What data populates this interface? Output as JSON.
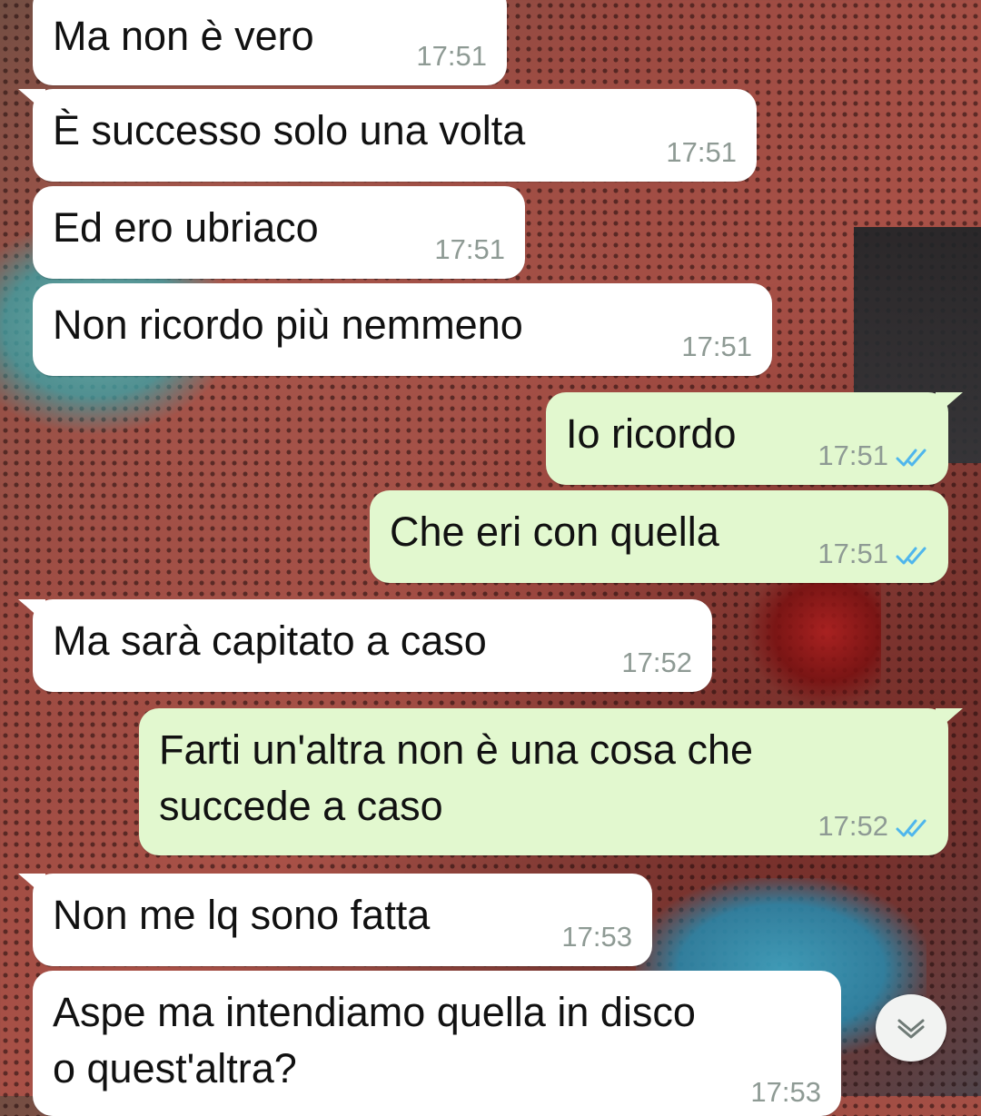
{
  "chat": {
    "messages": [
      {
        "direction": "in",
        "text": "Ma non è vero",
        "time": "17:51"
      },
      {
        "direction": "in",
        "text": "È successo solo una volta",
        "time": "17:51"
      },
      {
        "direction": "in",
        "text": "Ed ero ubriaco",
        "time": "17:51"
      },
      {
        "direction": "in",
        "text": "Non ricordo più nemmeno",
        "time": "17:51"
      },
      {
        "direction": "out",
        "text": "Io ricordo",
        "time": "17:51",
        "status": "read"
      },
      {
        "direction": "out",
        "text": "Che eri con quella",
        "time": "17:51",
        "status": "read"
      },
      {
        "direction": "in",
        "text": "Ma sarà capitato a caso",
        "time": "17:52"
      },
      {
        "direction": "out",
        "line1": "Farti un'altra non è una cosa che",
        "line2": "succede a caso",
        "time": "17:52",
        "status": "read"
      },
      {
        "direction": "in",
        "text": "Non me lq sono fatta",
        "time": "17:53"
      },
      {
        "direction": "in",
        "line1": "Aspe ma intendiamo quella in disco",
        "line2": "o quest'altra?",
        "time": "17:53"
      }
    ]
  },
  "icons": {
    "read_ticks": "double-check-icon",
    "scroll_down": "chevron-down-icon"
  },
  "colors": {
    "incoming_bubble": "#ffffff",
    "outgoing_bubble": "#e2f8cf",
    "read_tick": "#4fb6ec",
    "timestamp": "#8e9a94"
  }
}
